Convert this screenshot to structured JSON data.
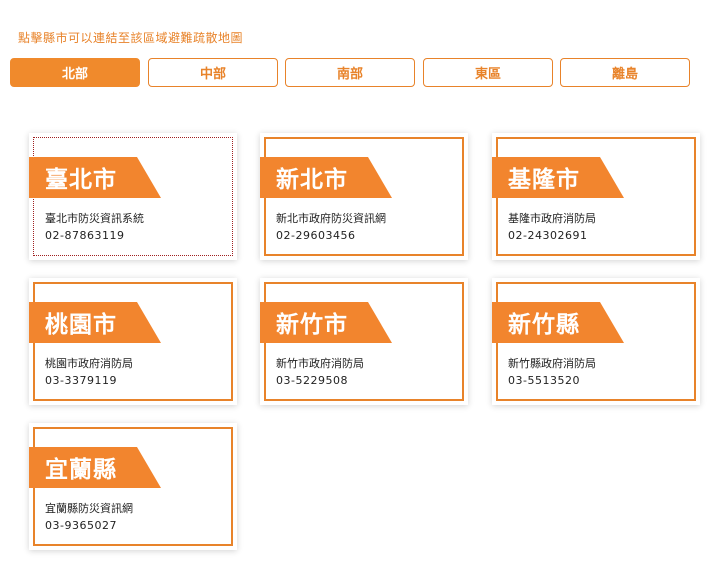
{
  "hint": "點擊縣市可以連結至該區域避難疏散地圖",
  "tabs": [
    {
      "label": "北部",
      "active": true
    },
    {
      "label": "中部",
      "active": false
    },
    {
      "label": "南部",
      "active": false
    },
    {
      "label": "東區",
      "active": false
    },
    {
      "label": "離島",
      "active": false
    }
  ],
  "cards": [
    {
      "name": "臺北市",
      "agency": "臺北市防災資訊系統",
      "phone": "02-87863119"
    },
    {
      "name": "新北市",
      "agency": "新北市政府防災資訊網",
      "phone": "02-29603456"
    },
    {
      "name": "基隆市",
      "agency": "基隆市政府消防局",
      "phone": "02-24302691"
    },
    {
      "name": "桃園市",
      "agency": "桃園市政府消防局",
      "phone": "03-3379119"
    },
    {
      "name": "新竹市",
      "agency": "新竹市政府消防局",
      "phone": "03-5229508"
    },
    {
      "name": "新竹縣",
      "agency": "新竹縣政府消防局",
      "phone": "03-5513520"
    },
    {
      "name": "宜蘭縣",
      "agency": "宜蘭縣防災資訊網",
      "phone": "03-9365027"
    }
  ],
  "colors": {
    "accent": "#f08a2c",
    "ribbon": "#f2852e",
    "hint": "#e8832a"
  }
}
